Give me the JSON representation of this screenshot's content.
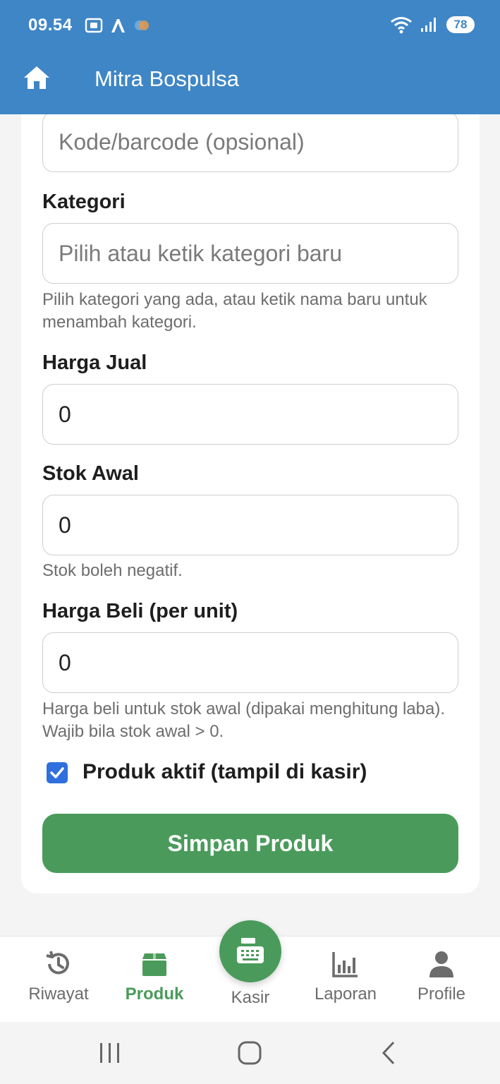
{
  "status_bar": {
    "time": "09.54",
    "battery": "78"
  },
  "app_bar": {
    "title": "Mitra Bospulsa"
  },
  "form": {
    "code_placeholder": "Kode/barcode (opsional)",
    "category_label": "Kategori",
    "category_placeholder": "Pilih atau ketik kategori baru",
    "category_help": "Pilih kategori yang ada, atau ketik nama baru untuk menambah kategori.",
    "sell_price_label": "Harga Jual",
    "sell_price_value": "0",
    "initial_stock_label": "Stok Awal",
    "initial_stock_value": "0",
    "stock_help": "Stok boleh negatif.",
    "buy_price_label": "Harga Beli (per unit)",
    "buy_price_value": "0",
    "buy_price_help": "Harga beli untuk stok awal (dipakai menghitung laba). Wajib bila stok awal > 0.",
    "active_label": "Produk aktif (tampil di kasir)",
    "active_checked": true,
    "save_label": "Simpan Produk"
  },
  "bottom_nav": {
    "items": [
      {
        "label": "Riwayat",
        "icon": "history-icon",
        "active": false
      },
      {
        "label": "Produk",
        "icon": "box-icon",
        "active": true
      },
      {
        "label": "Kasir",
        "icon": "cash-register-icon",
        "active": false
      },
      {
        "label": "Laporan",
        "icon": "bar-chart-icon",
        "active": false
      },
      {
        "label": "Profile",
        "icon": "person-icon",
        "active": false
      }
    ]
  },
  "colors": {
    "primary": "#3f86c6",
    "accent": "#4a9b5b",
    "checkbox": "#2f6fde"
  }
}
